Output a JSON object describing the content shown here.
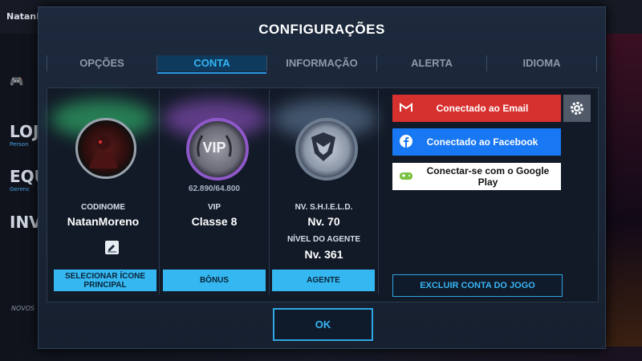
{
  "background": {
    "player_name": "NatanM",
    "side_labels": [
      "LOJ",
      "EQU",
      "INV"
    ],
    "side_sub": [
      "Person",
      "Gerenc",
      ""
    ],
    "novos": "NOVOS"
  },
  "dialog": {
    "title": "CONFIGURAÇÕES",
    "tabs": [
      {
        "label": "OPÇÕES",
        "active": false
      },
      {
        "label": "CONTA",
        "active": true
      },
      {
        "label": "INFORMAÇÃO",
        "active": false
      },
      {
        "label": "ALERTA",
        "active": false
      },
      {
        "label": "IDIOMA",
        "active": false
      }
    ],
    "profile": {
      "codename_label": "CODINOME",
      "codename": "NatanMoreno",
      "button": "SELECIONAR ÍCONE PRINCIPAL"
    },
    "vip": {
      "badge_text": "VIP",
      "progress": "62.890/64.800",
      "label": "VIP",
      "level": "Classe 8",
      "button": "BÔNUS"
    },
    "shield": {
      "level_label": "NV. S.H.I.E.L.D.",
      "level": "Nv. 70",
      "agent_label": "NÍVEL DO AGENTE",
      "agent_level": "Nv. 361",
      "button": "AGENTE"
    },
    "accounts": {
      "email": "Conectado ao Email",
      "facebook": "Conectado ao Facebook",
      "google": "Conectar-se com o Google Play",
      "delete": "EXCLUIR CONTA DO JOGO"
    },
    "ok": "OK",
    "colors": {
      "accent": "#35b8f2",
      "email": "#d7312f",
      "facebook": "#1877f2",
      "google_bg": "#ffffff",
      "panel": "#121a27"
    }
  }
}
